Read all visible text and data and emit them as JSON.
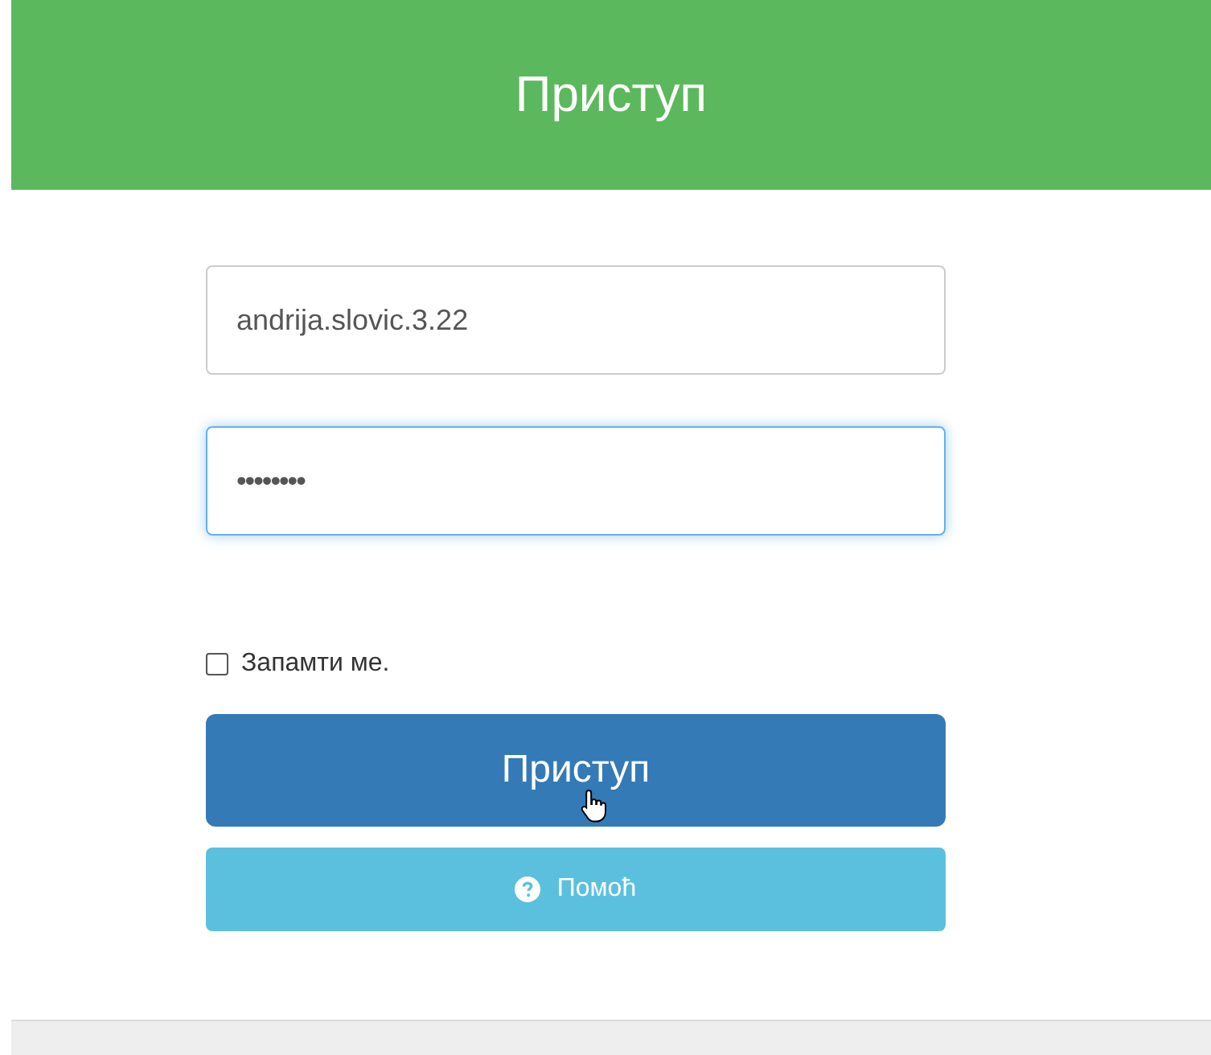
{
  "header": {
    "title": "Приступ"
  },
  "fields": [
    {
      "kind": "text",
      "value": "andrija.slovic.3.22",
      "focused": false
    },
    {
      "kind": "password",
      "value": "••••••••",
      "focused": true
    }
  ],
  "remember": {
    "label": "Запамти ме.",
    "checked": false
  },
  "buttons": [
    {
      "kind": "primary",
      "label": "Приступ"
    },
    {
      "kind": "help",
      "label": "Помоћ"
    }
  ]
}
